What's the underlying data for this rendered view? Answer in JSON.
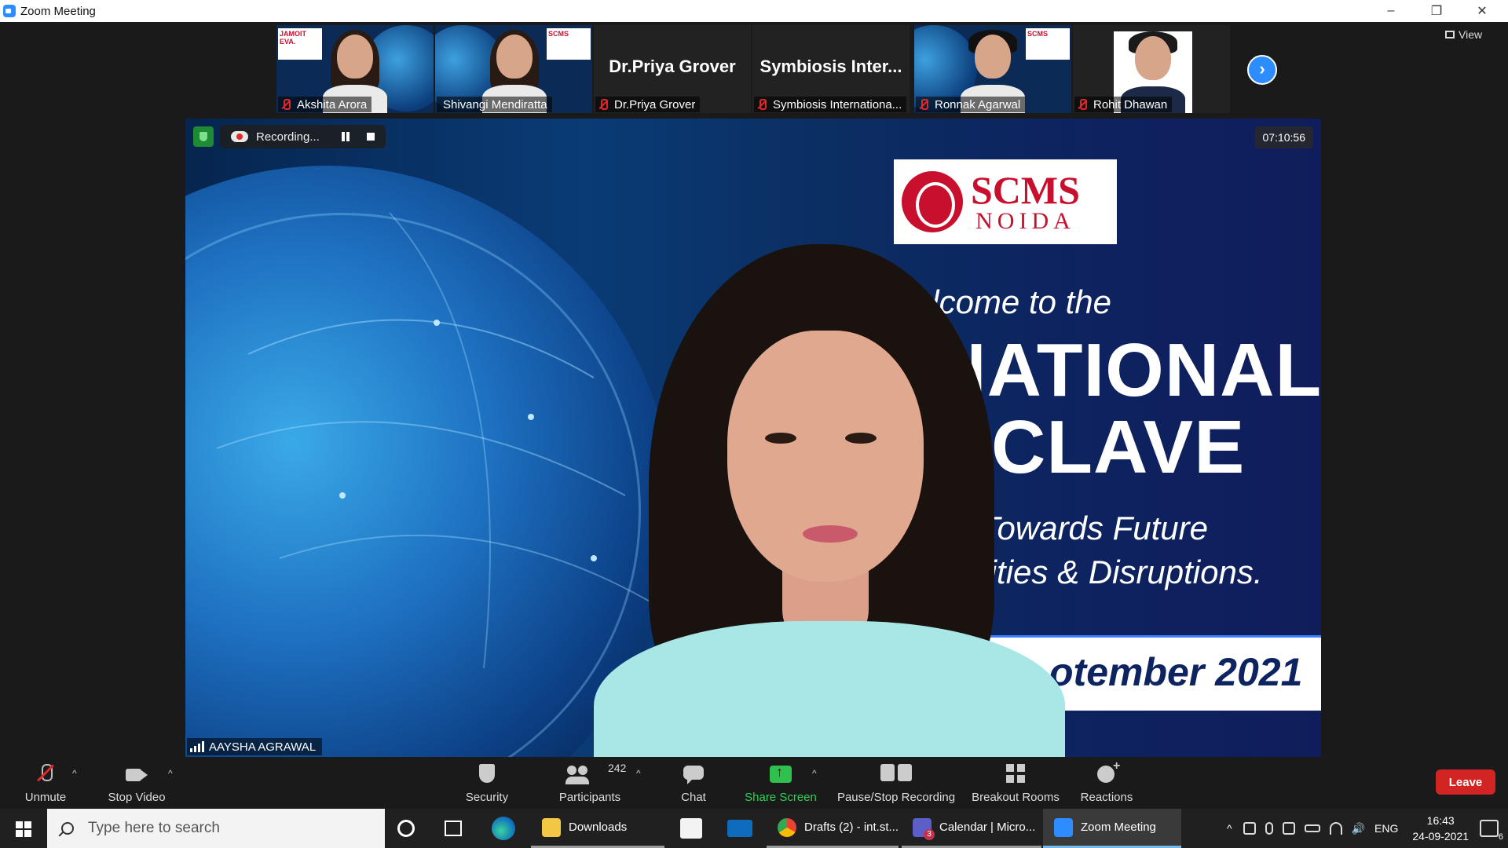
{
  "window": {
    "title": "Zoom Meeting",
    "controls": [
      "–",
      "❐",
      "✕"
    ]
  },
  "gallery": {
    "tiles": [
      {
        "name": "Akshita Arora",
        "muted": true,
        "kind": "video",
        "mini_badge": "JAMOIT EVA."
      },
      {
        "name": "Shivangi Mendiratta",
        "muted": false,
        "kind": "video",
        "mini_badge": "SCMS"
      },
      {
        "name": "Dr.Priya Grover",
        "display_name": "Dr.Priya Grover",
        "muted": true,
        "kind": "name"
      },
      {
        "name": "Symbiosis Internationa...",
        "display_name": "Symbiosis  Inter...",
        "muted": true,
        "kind": "name"
      },
      {
        "name": "Ronnak Agarwal",
        "muted": true,
        "kind": "video",
        "mini_badge": "SCMS"
      },
      {
        "name": "Rohit Dhawan",
        "muted": true,
        "kind": "photo"
      }
    ],
    "next_icon": "chevron-right-icon",
    "view_label": "View"
  },
  "main": {
    "recording_label": "Recording...",
    "timer": "07:10:56",
    "speaker_name": "AAYSHA AGRAWAL",
    "slide": {
      "brand_line1": "SCMS",
      "brand_line2": "NOIDA",
      "welcome": "Welcome to the",
      "headline1": "RNATIONAL",
      "headline2": "ONCLAVE",
      "sub1": "4.0: Towards Future",
      "sub2": "ortunities & Disruptions.",
      "date": "otember 2021"
    }
  },
  "toolbar": {
    "unmute": "Unmute",
    "stop_video": "Stop Video",
    "security": "Security",
    "participants": "Participants",
    "participants_count": "242",
    "chat": "Chat",
    "share_screen": "Share Screen",
    "pause_stop_recording": "Pause/Stop Recording",
    "breakout_rooms": "Breakout Rooms",
    "reactions": "Reactions",
    "leave": "Leave",
    "accent_green": "#30d158",
    "leave_color": "#d32424"
  },
  "taskbar": {
    "search_placeholder": "Type here to search",
    "apps": [
      {
        "label": "Downloads",
        "icon": "folder-icon"
      },
      {
        "label": "Drafts (2) - int.st...",
        "icon": "chrome-icon"
      },
      {
        "label": "Calendar | Micro...",
        "icon": "teams-icon",
        "badge": "3"
      },
      {
        "label": "Zoom Meeting",
        "icon": "zoom-icon"
      }
    ],
    "language": "ENG",
    "time": "16:43",
    "date": "24-09-2021",
    "notifications": "6"
  }
}
